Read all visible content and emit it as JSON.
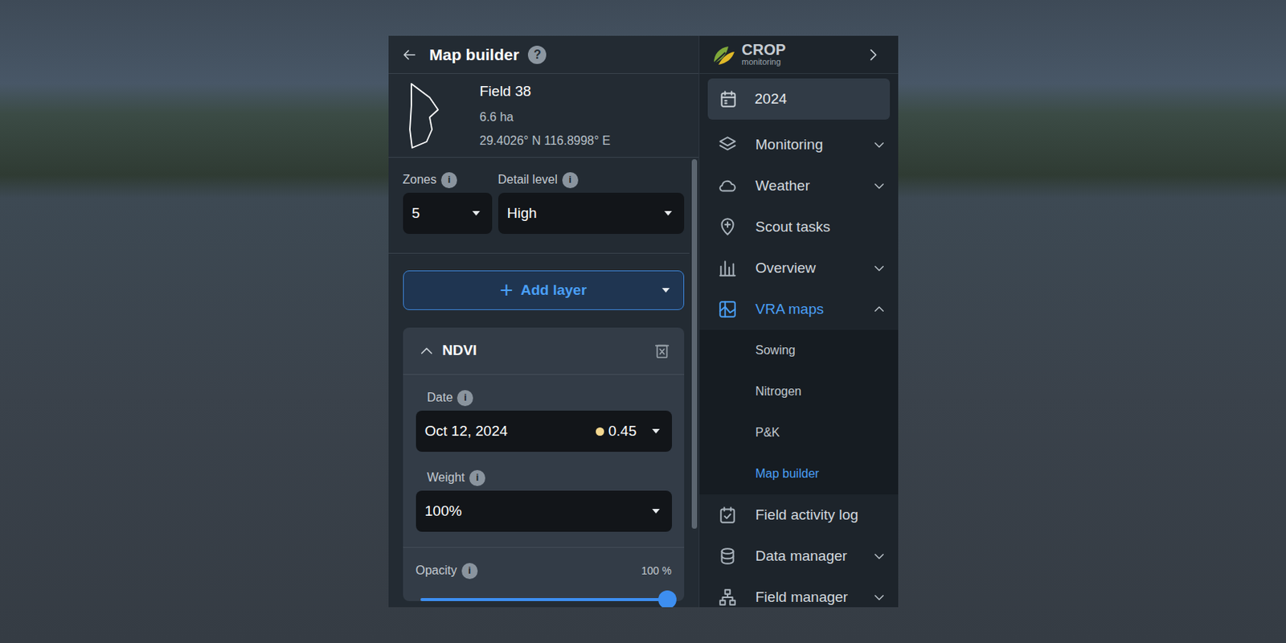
{
  "header": {
    "title": "Map builder",
    "help": "?"
  },
  "field": {
    "name": "Field 38",
    "area": "6.6 ha",
    "coords": "29.4026° N 116.8998° E"
  },
  "settings": [
    {
      "label": "Zones",
      "info": "i",
      "value": "5"
    },
    {
      "label": "Detail level",
      "info": "i",
      "value": "High"
    }
  ],
  "add_layer": {
    "icon": "+",
    "label": "Add layer"
  },
  "layer": {
    "title": "NDVI",
    "expanded": true,
    "date": {
      "label": "Date",
      "info": "i",
      "value": "Oct 12, 2024",
      "index": "0.45"
    },
    "weight": {
      "label": "Weight",
      "info": "i",
      "value": "100%"
    },
    "opacity": {
      "label": "Opacity",
      "info": "i",
      "reading": "100 %",
      "level": 1
    }
  },
  "sidebar": {
    "logo": {
      "title": "CROP",
      "subtitle": "monitoring"
    },
    "year": "2024",
    "items": [
      {
        "label": "Monitoring",
        "kind": "group",
        "expanded": false,
        "selected": false
      },
      {
        "label": "Weather",
        "kind": "group",
        "expanded": false,
        "selected": false
      },
      {
        "label": "Scout tasks",
        "kind": "link",
        "expanded": false,
        "selected": false
      },
      {
        "label": "Overview",
        "kind": "group",
        "expanded": false,
        "selected": false
      },
      {
        "label": "VRA maps",
        "kind": "group",
        "expanded": true,
        "selected": true,
        "children": [
          {
            "label": "Sowing",
            "selected": false
          },
          {
            "label": "Nitrogen",
            "selected": false
          },
          {
            "label": "P&K",
            "selected": false
          },
          {
            "label": "Map builder",
            "selected": true
          }
        ]
      },
      {
        "label": "Field activity log",
        "kind": "link",
        "expanded": false,
        "selected": false
      },
      {
        "label": "Data manager",
        "kind": "group",
        "expanded": false,
        "selected": false
      },
      {
        "label": "Field manager",
        "kind": "group",
        "expanded": false,
        "selected": false
      }
    ]
  }
}
